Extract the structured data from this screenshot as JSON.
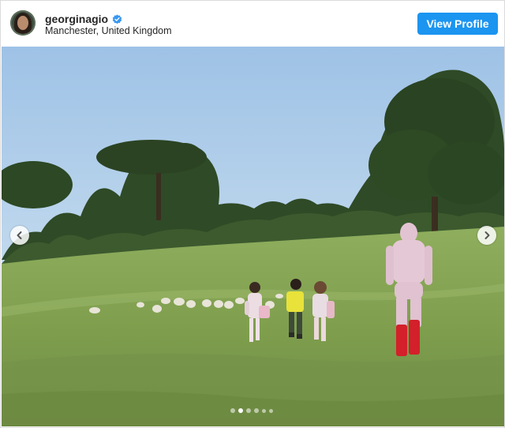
{
  "post": {
    "username": "georginagio",
    "location": "Manchester, United Kingdom",
    "view_profile_label": "View Profile"
  },
  "icons": {
    "verified": "verified-badge-icon",
    "prev": "chevron-left-icon",
    "next": "chevron-right-icon"
  },
  "carousel": {
    "total_slides": 6,
    "active_index": 1
  },
  "colors": {
    "button": "#1b95f0",
    "verified": "#3897f0",
    "sky": "#a9cbe8",
    "grass": "#8aa85a"
  }
}
